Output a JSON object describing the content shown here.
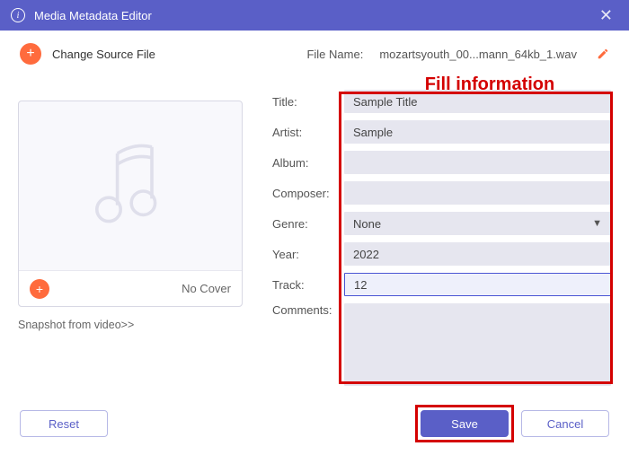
{
  "window": {
    "title": "Media Metadata Editor"
  },
  "toolbar": {
    "change_source": "Change Source File",
    "file_name_label": "File Name:",
    "file_name": "mozartsyouth_00...mann_64kb_1.wav"
  },
  "annotation": {
    "text": "Fill information"
  },
  "cover": {
    "no_cover": "No Cover",
    "snapshot": "Snapshot from video>>"
  },
  "form": {
    "title_label": "Title:",
    "title_value": "Sample Title",
    "artist_label": "Artist:",
    "artist_value": "Sample",
    "album_label": "Album:",
    "album_value": "",
    "composer_label": "Composer:",
    "composer_value": "",
    "genre_label": "Genre:",
    "genre_value": "None",
    "year_label": "Year:",
    "year_value": "2022",
    "track_label": "Track:",
    "track_value": "12",
    "comments_label": "Comments:",
    "comments_value": ""
  },
  "buttons": {
    "reset": "Reset",
    "save": "Save",
    "cancel": "Cancel"
  }
}
